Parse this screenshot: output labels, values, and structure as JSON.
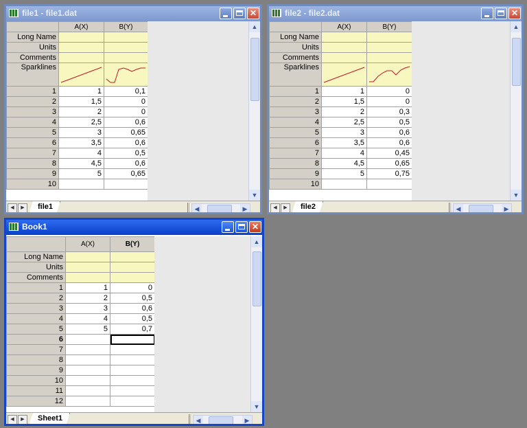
{
  "file1": {
    "title": "file1 - file1.dat",
    "columns": [
      "A(X)",
      "B(Y)"
    ],
    "meta_labels": [
      "Long Name",
      "Units",
      "Comments",
      "Sparklines"
    ],
    "rows": [
      [
        "1",
        "1",
        "0,1"
      ],
      [
        "2",
        "1,5",
        "0"
      ],
      [
        "3",
        "2",
        "0"
      ],
      [
        "4",
        "2,5",
        "0,6"
      ],
      [
        "5",
        "3",
        "0,65"
      ],
      [
        "6",
        "3,5",
        "0,6"
      ],
      [
        "7",
        "4",
        "0,5"
      ],
      [
        "8",
        "4,5",
        "0,6"
      ],
      [
        "9",
        "5",
        "0,65"
      ],
      [
        "10",
        "",
        ""
      ]
    ],
    "sheet_tab": "file1"
  },
  "file2": {
    "title": "file2 - file2.dat",
    "columns": [
      "A(X)",
      "B(Y)"
    ],
    "meta_labels": [
      "Long Name",
      "Units",
      "Comments",
      "Sparklines"
    ],
    "rows": [
      [
        "1",
        "1",
        "0"
      ],
      [
        "2",
        "1,5",
        "0"
      ],
      [
        "3",
        "2",
        "0,3"
      ],
      [
        "4",
        "2,5",
        "0,5"
      ],
      [
        "5",
        "3",
        "0,6"
      ],
      [
        "6",
        "3,5",
        "0,6"
      ],
      [
        "7",
        "4",
        "0,45"
      ],
      [
        "8",
        "4,5",
        "0,65"
      ],
      [
        "9",
        "5",
        "0,75"
      ],
      [
        "10",
        "",
        ""
      ]
    ],
    "sheet_tab": "file2"
  },
  "book1": {
    "title": "Book1",
    "columns": [
      "A(X)",
      "B(Y)"
    ],
    "meta_labels": [
      "Long Name",
      "Units",
      "Comments"
    ],
    "rows": [
      [
        "1",
        "1",
        "0"
      ],
      [
        "2",
        "2",
        "0,5"
      ],
      [
        "3",
        "3",
        "0,6"
      ],
      [
        "4",
        "4",
        "0,5"
      ],
      [
        "5",
        "5",
        "0,7"
      ],
      [
        "6",
        "",
        ""
      ],
      [
        "7",
        "",
        ""
      ],
      [
        "8",
        "",
        ""
      ],
      [
        "9",
        "",
        ""
      ],
      [
        "10",
        "",
        ""
      ],
      [
        "11",
        "",
        ""
      ],
      [
        "12",
        "",
        ""
      ]
    ],
    "sheet_tab": "Sheet1"
  },
  "colors": {
    "active_title": "#0a3fc9",
    "inactive_title": "#7d98cd",
    "meta_fill": "#f9f7c0",
    "sparkline": "#c0142a"
  },
  "icons": [
    "worksheet-icon",
    "minimize-icon",
    "maximize-icon",
    "close-icon",
    "scroll-up-icon",
    "scroll-down-icon",
    "scroll-left-icon",
    "scroll-right-icon"
  ]
}
